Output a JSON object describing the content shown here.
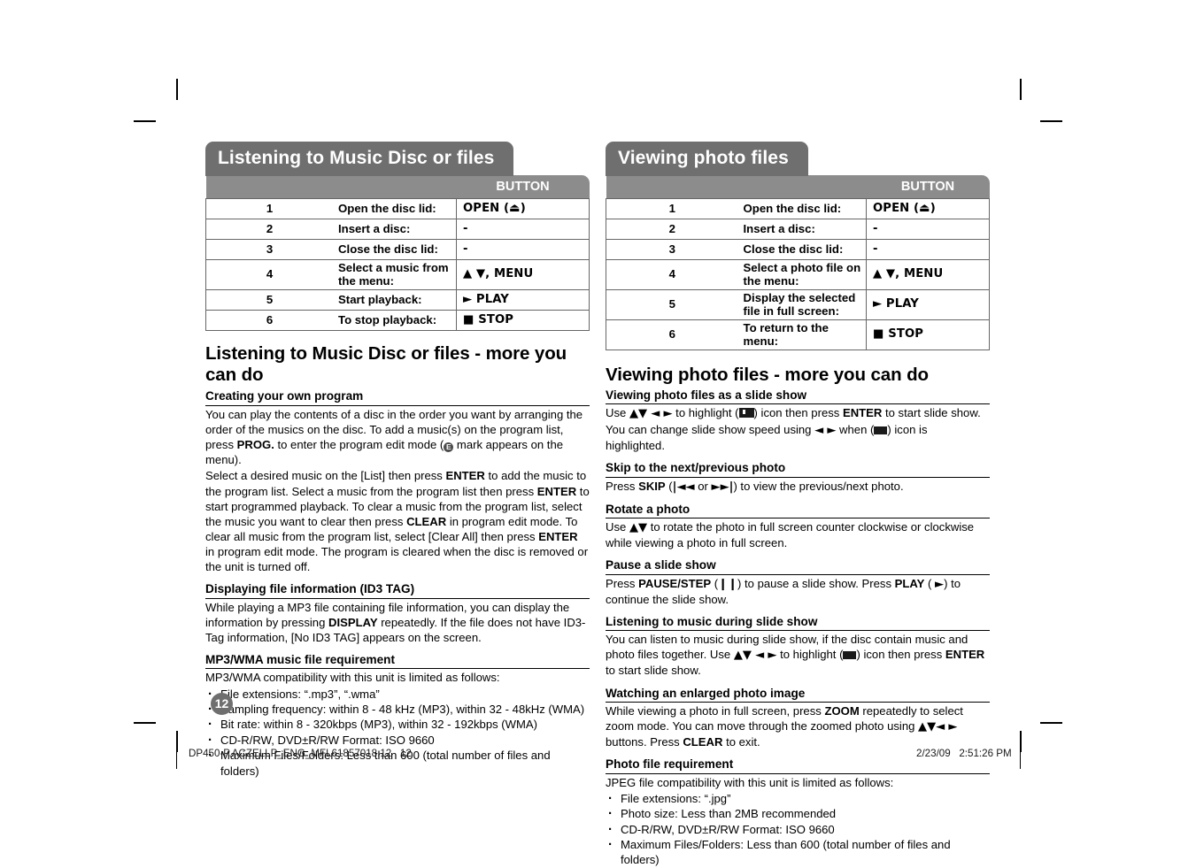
{
  "page": {
    "number": "12",
    "footer_file": "DP450-P.ACZELLP_ENG_MFL61857018.12   12",
    "footer_date": "2/23/09   2:51:26 PM"
  },
  "colors": {
    "banner_title_bg": "#6f6f6f",
    "banner_header_bg": "#8c8c8c",
    "table_border": "#666666",
    "text": "#000000"
  },
  "left": {
    "banner": {
      "title": "Listening to Music Disc or files",
      "col_desc_header": "",
      "col_button_header": "BUTTON",
      "rows": [
        {
          "num": "1",
          "desc": "Open the disc lid:",
          "button": "OPEN (⏏)"
        },
        {
          "num": "2",
          "desc": "Insert a disc:",
          "button": "-"
        },
        {
          "num": "3",
          "desc": "Close the disc lid:",
          "button": "-"
        },
        {
          "num": "4",
          "desc": "Select a music from the menu:",
          "button": "▲ ▼, MENU"
        },
        {
          "num": "5",
          "desc": "Start playback:",
          "button": "►  PLAY"
        },
        {
          "num": "6",
          "desc": "To stop playback:",
          "button": "■  STOP"
        }
      ]
    },
    "heading": "Listening to Music Disc or files - more you can do",
    "sections": [
      {
        "title": "Creating your own program",
        "paragraphs": [
          "You can play the contents of a disc in the order you want by arranging the order of the musics on the disc. To add a music(s) on the program list, press PROG. to enter the program edit mode (E mark appears on the menu).",
          "Select a desired music on the [List] then press ENTER to add the music to the program list. Select a music from the program list then press ENTER to start programmed playback. To clear a music from the program list, select the music you want to clear then press CLEAR in program edit mode. To clear all music from the program list, select [Clear All] then press ENTER in program edit mode. The program is cleared when the disc is removed or the unit is turned off."
        ]
      },
      {
        "title": "Displaying file information (ID3 TAG)",
        "paragraphs": [
          "While playing a MP3 file containing file information, you can display the information by pressing DISPLAY repeatedly. If the file does not have ID3-Tag information, [No ID3 TAG] appears on the screen."
        ]
      },
      {
        "title": "MP3/WMA music file requirement",
        "intro": "MP3/WMA compatibility with this unit is limited as follows:",
        "bullets": [
          "File extensions: “.mp3”, “.wma”",
          "Sampling frequency: within 8 - 48 kHz (MP3), within 32 - 48kHz (WMA)",
          "Bit rate: within 8 - 320kbps (MP3), within 32 - 192kbps (WMA)",
          "CD-R/RW, DVD±R/RW Format: ISO 9660",
          "Maximum Files/Folders: Less than 600 (total number of files and folders)"
        ]
      }
    ]
  },
  "right": {
    "banner": {
      "title": "Viewing photo files",
      "col_desc_header": "",
      "col_button_header": "BUTTON",
      "rows": [
        {
          "num": "1",
          "desc": "Open the disc lid:",
          "button": "OPEN (⏏)"
        },
        {
          "num": "2",
          "desc": "Insert a disc:",
          "button": "-"
        },
        {
          "num": "3",
          "desc": "Close the disc lid:",
          "button": "-"
        },
        {
          "num": "4",
          "desc": "Select a photo file on the menu:",
          "button": "▲ ▼, MENU"
        },
        {
          "num": "5",
          "desc": "Display the selected file in full screen:",
          "button": "►  PLAY"
        },
        {
          "num": "6",
          "desc": "To return to the menu:",
          "button": "■ STOP"
        }
      ]
    },
    "heading": "Viewing photo files - more you can do",
    "sections": [
      {
        "title": "Viewing photo files as a slide show",
        "paragraphs": [
          "Use ▲▼ ◄ ► to highlight ( ) icon then press ENTER to start slide show.",
          "You can change slide show speed using ◄ ► when ( ) icon is highlighted."
        ]
      },
      {
        "title": "Skip to the next/previous photo",
        "paragraphs": [
          "Press SKIP (|◄◄ or ►►|) to view the previous/next photo."
        ]
      },
      {
        "title": "Rotate a photo",
        "paragraphs": [
          "Use ▲▼ to rotate the photo in full screen counter clockwise or clockwise while viewing a photo in full screen."
        ]
      },
      {
        "title": "Pause a slide show",
        "paragraphs": [
          "Press PAUSE/STEP (‖) to pause a slide show. Press PLAY ( ►) to continue the slide show."
        ]
      },
      {
        "title": "Listening to music during slide show",
        "paragraphs": [
          "You can listen to music during slide show, if the disc contain music and photo files together. Use ▲▼ ◄ ► to highlight ( ) icon then press ENTER to start slide show."
        ]
      },
      {
        "title": "Watching an enlarged photo image",
        "paragraphs": [
          "While viewing a photo in full screen, press ZOOM repeatedly to select zoom mode. You can move through the zoomed photo using ▲▼◄ ► buttons. Press CLEAR to exit."
        ]
      },
      {
        "title": "Photo file requirement",
        "intro": "JPEG file compatibility with this unit is limited as follows:",
        "bullets": [
          "File extensions: “.jpg”",
          "Photo size: Less than 2MB recommended",
          "CD-R/RW, DVD±R/RW Format: ISO 9660",
          "Maximum Files/Folders: Less than 600 (total number of files and folders)"
        ]
      }
    ]
  }
}
